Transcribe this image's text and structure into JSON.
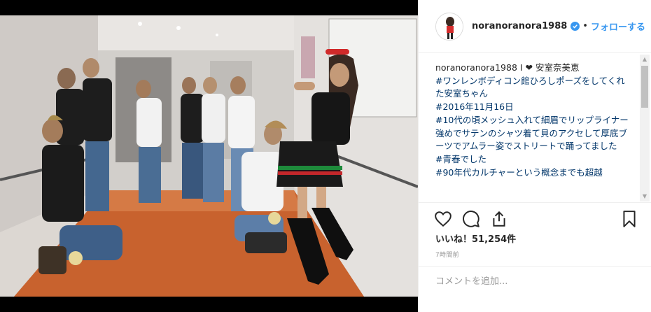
{
  "post": {
    "username": "noranoranora1988",
    "follow_label": "フォローする",
    "separator": "•"
  },
  "caption": {
    "username": "noranoranora1988",
    "lines": [
      " I ❤ 安室奈美恵",
      "",
      "#ワンレンボディコン館ひろしポーズをしてくれた安室ちゃん",
      "#2016年11月16日",
      "#10代の頃メッシュ入れて細眉でリップライナー強めでサテンのシャツ着て貝のアクセして厚底ブーツでアムラー姿でストリートで踊ってました",
      "#青春でした",
      "#90年代カルチャーという概念までも超越"
    ]
  },
  "engagement": {
    "likes_text": "いいね！51,254件",
    "time_text": "7時間前"
  },
  "comment": {
    "placeholder": "コメントを追加..."
  },
  "icons": {
    "like": "heart-icon",
    "comment": "comment-icon",
    "share": "share-icon",
    "save": "bookmark-icon",
    "verified": "verified-badge-icon"
  },
  "colors": {
    "accent": "#3897f0",
    "text": "#262626",
    "muted": "#999999",
    "hashtag": "#003569"
  }
}
